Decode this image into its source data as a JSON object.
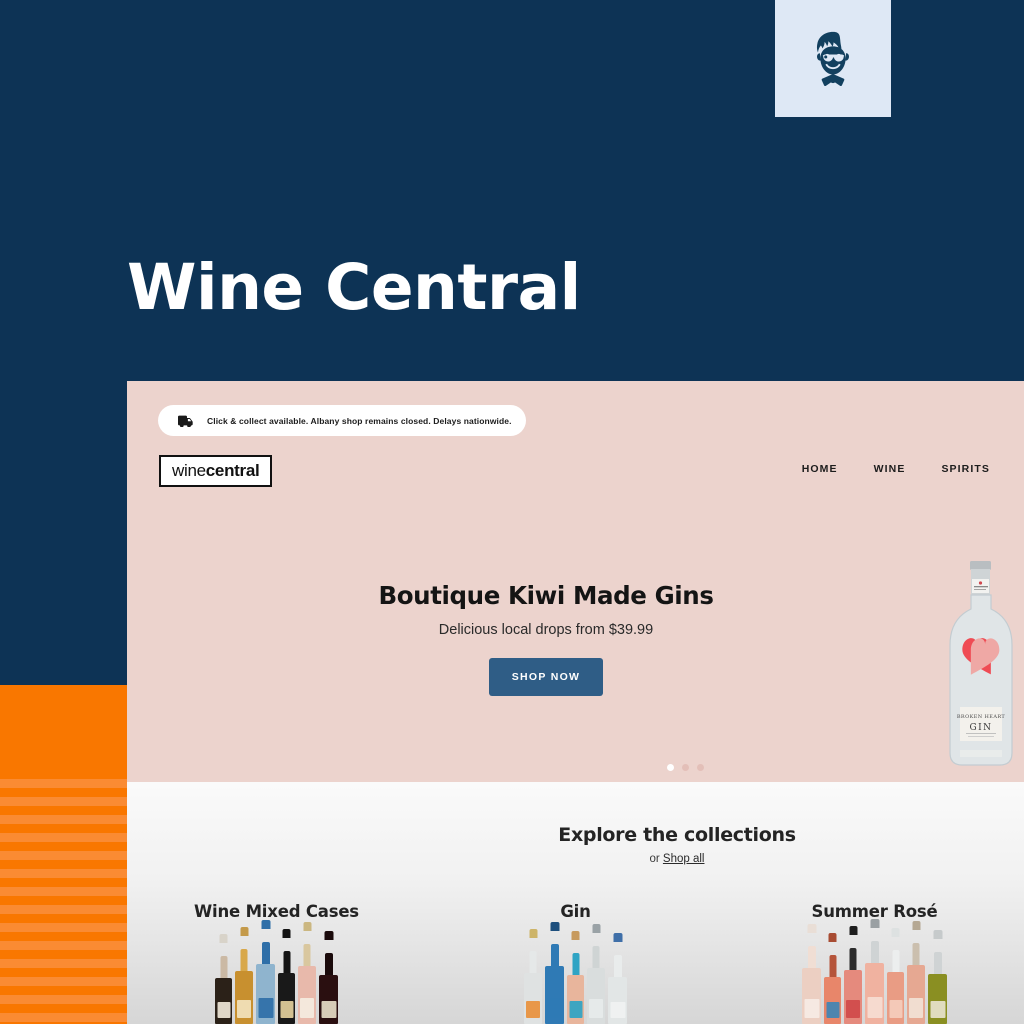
{
  "brand": {
    "title": "Wine Central",
    "navy": "#0d3355",
    "orange": "#f97700",
    "orange_light": "#fa8b33",
    "badge_bg": "#dee8f5",
    "logo_icon": "boy-with-glasses-bowtie-icon"
  },
  "site": {
    "background": "#ecd3cd",
    "announcement": {
      "icon": "delivery-truck-icon",
      "text": "Click & collect available. Albany shop remains closed. Delays nationwide."
    },
    "logo": {
      "light": "wine",
      "bold": "central"
    },
    "nav": [
      {
        "label": "HOME",
        "name": "nav-home"
      },
      {
        "label": "WINE",
        "name": "nav-wine"
      },
      {
        "label": "SPIRITS",
        "name": "nav-spirits"
      }
    ],
    "hero": {
      "title": "Boutique Kiwi Made Gins",
      "subtitle": "Delicious local drops from $39.99",
      "cta": "SHOP NOW",
      "cta_color": "#2f5d86",
      "bottle": {
        "brand": "BROKEN HEART",
        "product": "GIN",
        "accent": "#ef4b54"
      },
      "carousel": {
        "total": 3,
        "active": 1
      }
    },
    "collections": {
      "heading": "Explore the collections",
      "sub_prefix": "or ",
      "sub_link": "Shop all",
      "cards": [
        {
          "title": "Wine Mixed Cases",
          "bottles": [
            {
              "body": "#2b2118",
              "neck": "#cbb9a4",
              "cap": "#d8d3c9",
              "label": "#efe7d8"
            },
            {
              "body": "#c8902f",
              "neck": "#d8a84a",
              "cap": "#c49a4a",
              "label": "#f2e3bd"
            },
            {
              "body": "#8fb4ce",
              "neck": "#2f6fa8",
              "cap": "#2f6fa8",
              "label": "#2f6fa8"
            },
            {
              "body": "#191919",
              "neck": "#141414",
              "cap": "#141414",
              "label": "#e3cf9c"
            },
            {
              "body": "#e8b9ab",
              "neck": "#d9c79f",
              "cap": "#cbb781",
              "label": "#f4ece0"
            },
            {
              "body": "#2a0f10",
              "neck": "#1a0a0b",
              "cap": "#1a0a0b",
              "label": "#e6dcc6"
            }
          ]
        },
        {
          "title": "Gin",
          "bottles": [
            {
              "body": "#dfe2e2",
              "neck": "#e5e8e8",
              "cap": "#cdb468",
              "label": "#e8903c"
            },
            {
              "body": "#2f7ab5",
              "neck": "#2f7ab5",
              "cap": "#1d4f7d",
              "label": "#2f7ab5"
            },
            {
              "body": "#e8b59c",
              "neck": "#2fa4c4",
              "cap": "#c79a5e",
              "label": "#2fa4c4"
            },
            {
              "body": "#d9dddd",
              "neck": "#cfd4d4",
              "cap": "#9aa2a6",
              "label": "#e7eaea"
            },
            {
              "body": "#e2e6e6",
              "neck": "#e9ecec",
              "cap": "#3f6fa8",
              "label": "#f0f2f2"
            }
          ]
        },
        {
          "title": "Summer Rosé",
          "bottles": [
            {
              "body": "#eccfc2",
              "neck": "#f0ded4",
              "cap": "#e9ded6",
              "label": "#f6ece5"
            },
            {
              "body": "#e8866a",
              "neck": "#b5543a",
              "cap": "#a84c32",
              "label": "#3f86b5"
            },
            {
              "body": "#e58a7d",
              "neck": "#2c2c2c",
              "cap": "#1e1e1e",
              "label": "#d04a4a"
            },
            {
              "body": "#f0b2a0",
              "neck": "#cfd3d4",
              "cap": "#9aa0a3",
              "label": "#f6ddd2"
            },
            {
              "body": "#e99c84",
              "neck": "#eceeee",
              "cap": "#dde1e1",
              "label": "#f4cdbd"
            },
            {
              "body": "#e6a892",
              "neck": "#cbbfae",
              "cap": "#b5a893",
              "label": "#f2e2d6"
            },
            {
              "body": "#8a8f22",
              "neck": "#cfd3d4",
              "cap": "#c6cacb",
              "label": "#e7e3cd"
            }
          ]
        }
      ]
    }
  }
}
